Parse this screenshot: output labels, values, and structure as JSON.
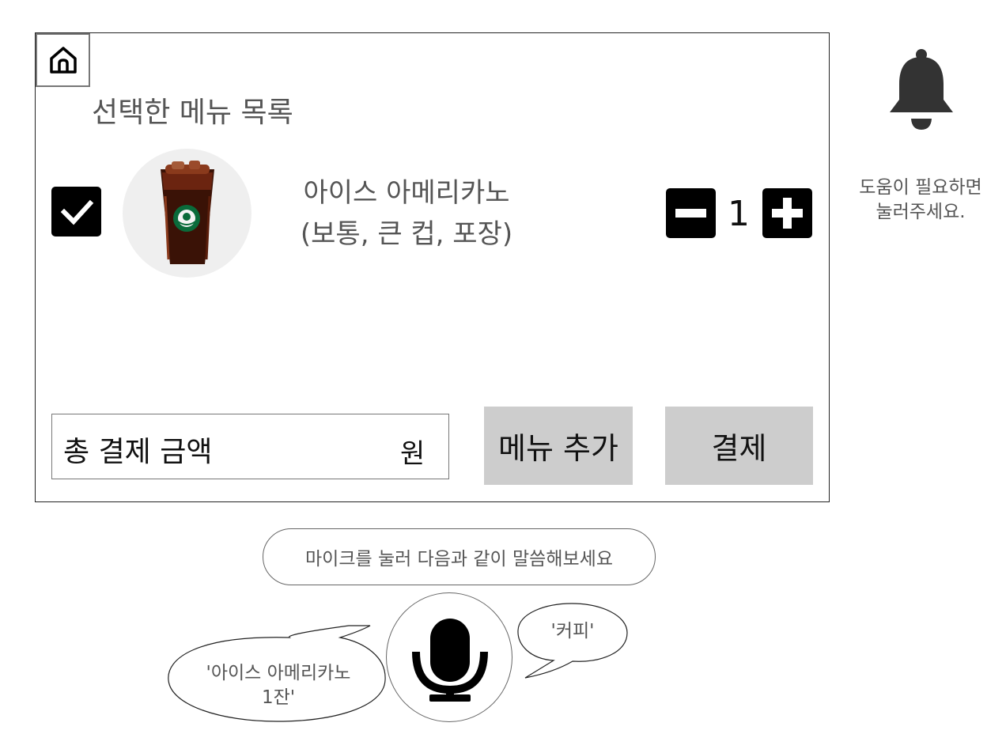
{
  "header": {
    "home_icon": "home-icon",
    "title": "선택한 메뉴 목록"
  },
  "order_item": {
    "checked": true,
    "image_icon": "iced-americano-photo",
    "name_line1": "아이스 아메리카노",
    "name_line2": "(보통, 큰 컵, 포장)",
    "quantity": "1"
  },
  "footer": {
    "total_label": "총 결제 금액",
    "total_unit": "원",
    "add_menu_label": "메뉴 추가",
    "pay_label": "결제"
  },
  "help": {
    "bell_icon": "bell-icon",
    "text_line1": "도움이 필요하면",
    "text_line2": "눌러주세요."
  },
  "voice": {
    "hint": "마이크를 눌러 다음과 같이 말씀해보세요",
    "mic_icon": "microphone-icon",
    "example_left_line1": "'아이스 아메리카노",
    "example_left_line2": "1잔'",
    "example_right": "'커피'"
  },
  "colors": {
    "button_gray": "#cdcdcd",
    "icon_black": "#000000",
    "text_gray": "#555555",
    "bell": "#333333"
  }
}
